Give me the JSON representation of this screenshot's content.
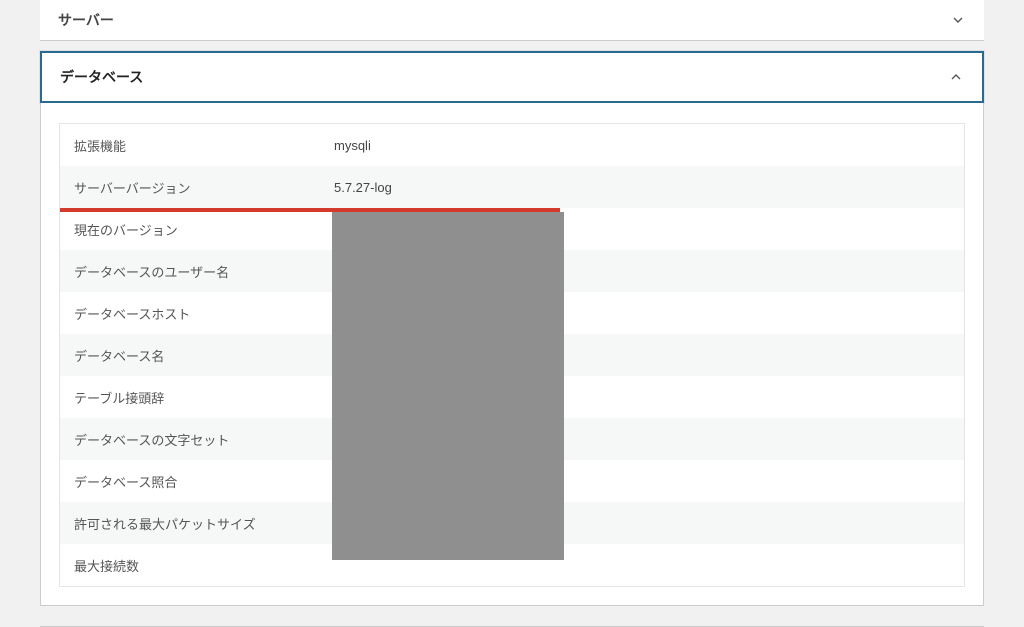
{
  "sections": {
    "server": {
      "title": "サーバー"
    },
    "database": {
      "title": "データベース",
      "rows": [
        {
          "label": "拡張機能",
          "value": "mysqli"
        },
        {
          "label": "サーバーバージョン",
          "value": "5.7.27-log"
        },
        {
          "label": "現在のバージョン",
          "value": ""
        },
        {
          "label": "データベースのユーザー名",
          "value": ""
        },
        {
          "label": "データベースホスト",
          "value": ""
        },
        {
          "label": "データベース名",
          "value": ""
        },
        {
          "label": "テーブル接頭辞",
          "value": ""
        },
        {
          "label": "データベースの文字セット",
          "value": ""
        },
        {
          "label": "データベース照合",
          "value": ""
        },
        {
          "label": "許可される最大パケットサイズ",
          "value": ""
        },
        {
          "label": "最大接続数",
          "value": ""
        }
      ]
    }
  }
}
